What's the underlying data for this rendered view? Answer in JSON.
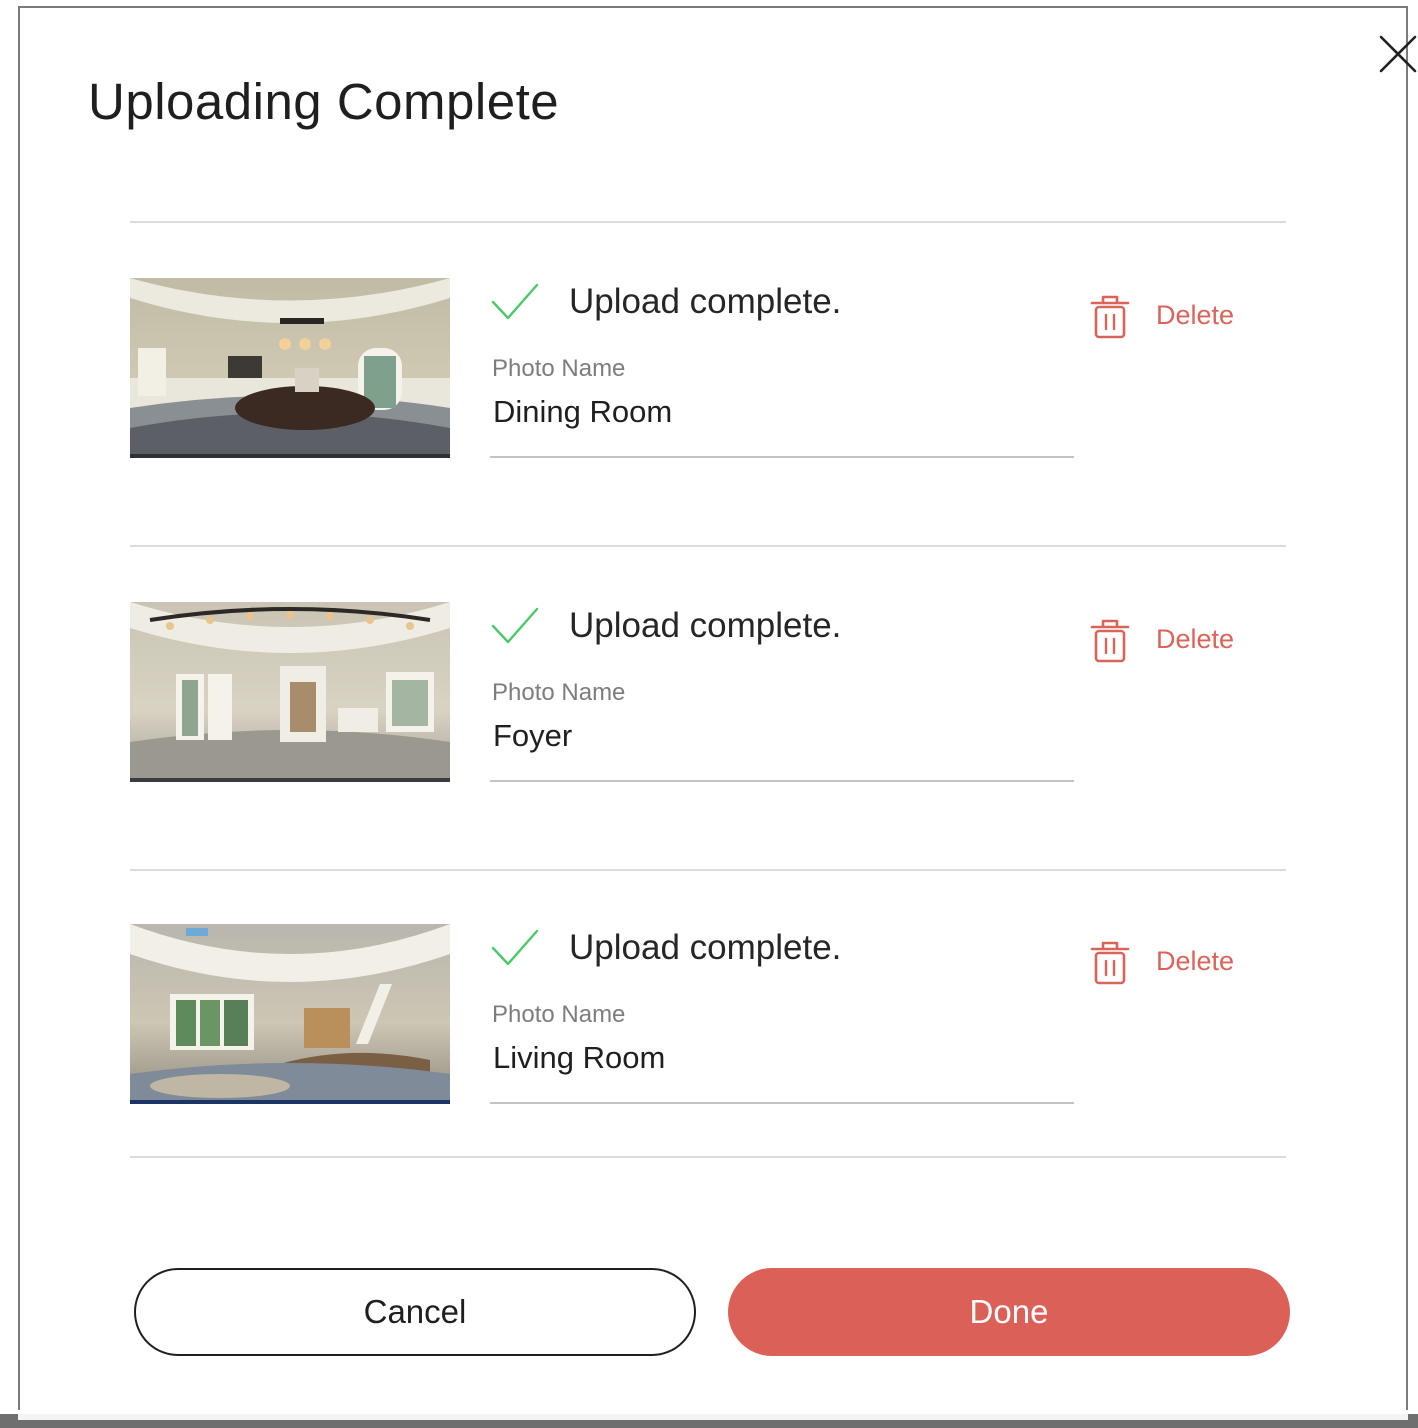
{
  "dialog": {
    "title": "Uploading Complete",
    "close_icon": "close-icon"
  },
  "uploads": [
    {
      "status": "Upload complete.",
      "field_label": "Photo Name",
      "photo_name": "Dining Room",
      "delete_label": "Delete"
    },
    {
      "status": "Upload complete.",
      "field_label": "Photo Name",
      "photo_name": "Foyer",
      "delete_label": "Delete"
    },
    {
      "status": "Upload complete.",
      "field_label": "Photo Name",
      "photo_name": "Living Room",
      "delete_label": "Delete"
    }
  ],
  "footer": {
    "cancel_label": "Cancel",
    "done_label": "Done"
  },
  "colors": {
    "accent": "#db6158",
    "success": "#4cc76a",
    "text": "#1f1f1f",
    "muted": "#7d7d7d"
  }
}
